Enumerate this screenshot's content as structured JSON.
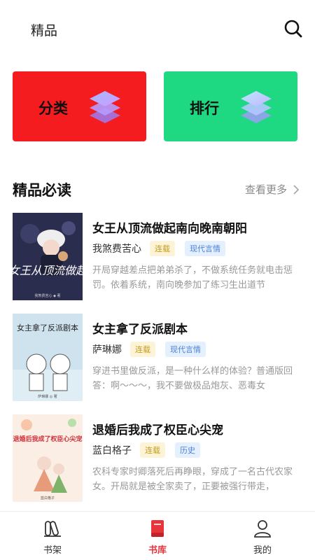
{
  "header": {
    "title": "精品"
  },
  "categories": [
    {
      "label": "分类",
      "color": "#f41c1f"
    },
    {
      "label": "排行",
      "color": "#1ed982"
    }
  ],
  "section": {
    "title": "精品必读",
    "more_label": "查看更多"
  },
  "books": [
    {
      "title": "女王从顶流做起南向晚南朝阳",
      "author": "我煞费苦心",
      "status": "连载",
      "genre": "现代言情",
      "description": "开局穿越差点把弟弟杀了，不做系统任务就电击惩罚。依着系统，南向晚参加了练习生出道节",
      "cover_text": "女王从顶流做起",
      "cover_author": "我煞费苦心 ◆ 著"
    },
    {
      "title": "女主拿了反派剧本",
      "author": "萨琳娜",
      "status": "连载",
      "genre": "现代言情",
      "description": "穿进书里做反派，是一种什么样的体验？普通版回答：啊～～～，我不要做极品炮灰、恶毒女",
      "cover_text": "女主拿了反派剧本",
      "cover_author": "萨琳娜 ◎ 著"
    },
    {
      "title": "退婚后我成了权臣心尖宠",
      "author": "蓝白格子",
      "status": "连载",
      "genre": "历史",
      "description": "农科专家时卿落死后再睁眼，穿成了一名古代农家女。开局就是被全家卖了，正要被强行带走，",
      "cover_text": "退婚后我成了权臣心尖宠",
      "cover_author": "蓝白格子"
    }
  ],
  "tabs": [
    {
      "label": "书架",
      "icon": "bookshelf-icon",
      "active": false
    },
    {
      "label": "书库",
      "icon": "library-icon",
      "active": true
    },
    {
      "label": "我的",
      "icon": "profile-icon",
      "active": false
    }
  ],
  "colors": {
    "accent": "#e8343b",
    "status_tag_text": "#c49a1b",
    "genre_tag_text": "#4b7fd6"
  }
}
